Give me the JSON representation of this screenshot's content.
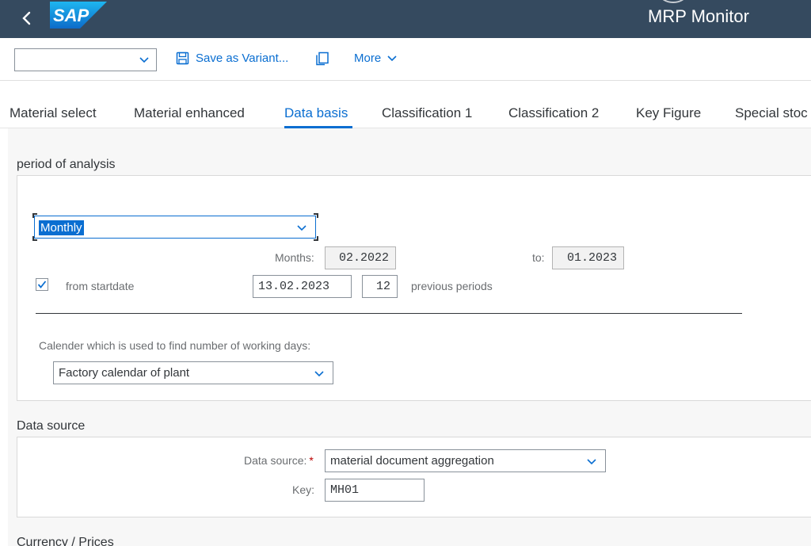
{
  "shell": {
    "logo_text": "SAP",
    "title": "MRP Monitor"
  },
  "toolbar": {
    "variant_value": "",
    "save_label": "Save as Variant...",
    "more_label": "More"
  },
  "tabs": [
    {
      "label": "Material select"
    },
    {
      "label": "Material enhanced"
    },
    {
      "label": "Data basis",
      "active": true
    },
    {
      "label": "Classification 1"
    },
    {
      "label": "Classification 2"
    },
    {
      "label": "Key Figure"
    },
    {
      "label": "Special stoc"
    }
  ],
  "period": {
    "section_title": "period of analysis",
    "period_type_value": "Monthly",
    "months_label": "Months:",
    "months_from": "02.2022",
    "to_label": "to:",
    "months_to": "01.2023",
    "from_startdate_checked": true,
    "from_startdate_label": "from startdate",
    "startdate_value": "13.02.2023",
    "periods_value": "12",
    "previous_periods_label": "previous periods",
    "calendar_label": "Calender which is used to find number of working days:",
    "calendar_value": "Factory calendar of plant"
  },
  "data_source": {
    "section_title": "Data source",
    "source_label": "Data source:",
    "source_value": "material document aggregation",
    "key_label": "Key:",
    "key_value": "MH01"
  },
  "currency": {
    "section_title": "Currency / Prices"
  },
  "colors": {
    "shell": "#354a5f",
    "accent": "#0a6ed1",
    "required": "#bb0000"
  }
}
